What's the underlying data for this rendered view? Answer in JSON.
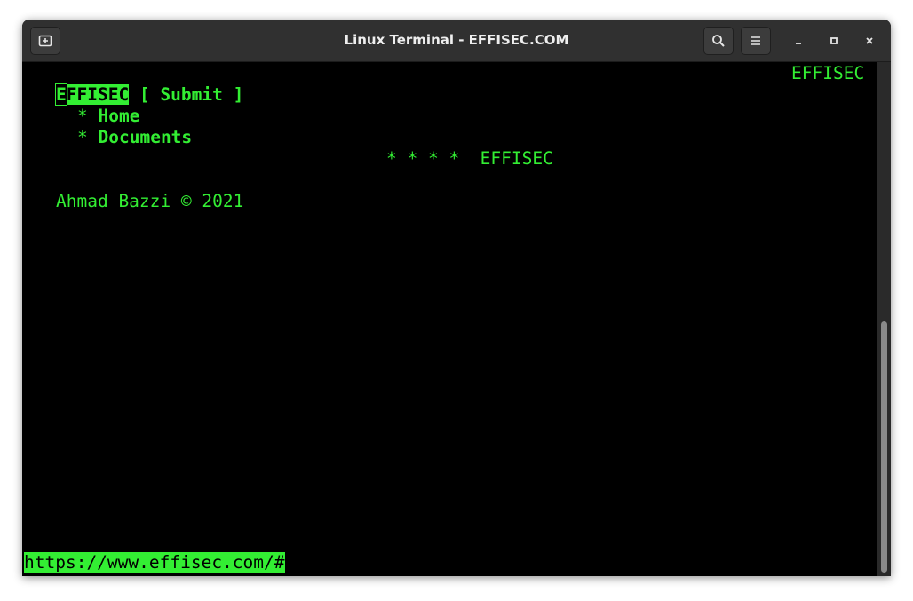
{
  "window": {
    "title": "Linux Terminal - EFFISEC.COM"
  },
  "titlebar": {
    "new_tab_icon": "new-tab-icon",
    "search_icon": "search-icon",
    "menu_icon": "hamburger-menu-icon",
    "minimize_icon": "minimize-icon",
    "maximize_icon": "maximize-icon",
    "close_icon": "close-icon"
  },
  "terminal": {
    "top_right_label": "EFFISEC",
    "nav": {
      "site_name_cursor_char": "E",
      "site_name_rest": "FFISEC",
      "submit_label": "[ Submit ]",
      "menu_items": [
        {
          "bullet": "*",
          "label": "Home"
        },
        {
          "bullet": "*",
          "label": "Documents"
        }
      ]
    },
    "banner": "* * * *  EFFISEC",
    "footer": "Ahmad Bazzi © 2021",
    "status_url": "https://www.effisec.com/#"
  },
  "colors": {
    "terminal_green": "#33ee33",
    "terminal_bg": "#000000",
    "titlebar_bg": "#303030"
  }
}
